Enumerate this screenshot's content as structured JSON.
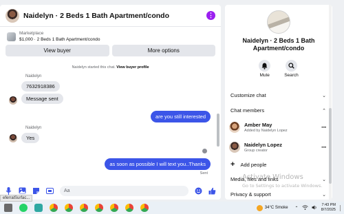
{
  "chat": {
    "title": "Naidelyn · 2 Beds 1 Bath Apartment/condo",
    "listing": {
      "kicker": "Marketplace",
      "price_line": "$1,000 · 2 Beds 1 Bath Apartment/condo"
    },
    "buttons": {
      "view_buyer": "View buyer",
      "more_options": "More options"
    },
    "system_note": {
      "prefix": "Naidelyn started this chat.",
      "link": "View buyer profile"
    },
    "messages": [
      {
        "sender": "Naidelyn",
        "text": "7632918386",
        "dir": "in"
      },
      {
        "text": "Message sent",
        "dir": "in"
      },
      {
        "text": "are you still interested",
        "dir": "out"
      },
      {
        "sender": "Naidelyn",
        "text": "Yes",
        "dir": "in"
      },
      {
        "text": "as soon as possible I will text you..Thanks",
        "dir": "out"
      }
    ],
    "sent_label": "Sent",
    "composer": {
      "placeholder": "Aa"
    }
  },
  "details": {
    "title": "Naidelyn · 2 Beds 1 Bath Apartment/condo",
    "actions": [
      {
        "label": "Mute",
        "icon": "bell-icon"
      },
      {
        "label": "Search",
        "icon": "search-icon"
      }
    ],
    "customize_chat": "Customize chat",
    "chat_members": "Chat members",
    "members": [
      {
        "name": "Amber May",
        "sub": "Added by Naidelyn Lopez"
      },
      {
        "name": "Naidelyn Lopez",
        "sub": "Group creator"
      }
    ],
    "add_people": "Add people",
    "media_files_links": "Media, files and links",
    "privacy_support": "Privacy & support",
    "watermark": {
      "title": "Activate Windows",
      "sub": "Go to Settings to activate Windows."
    }
  },
  "taskbar": {
    "tooltip": "eferralSurfac...",
    "weather": "34°C  Smoke",
    "time": "7:43 PM",
    "date": "8/7/2025"
  },
  "colors": {
    "accent": "#3c55e8",
    "more_purple": "#9b1ff0"
  }
}
